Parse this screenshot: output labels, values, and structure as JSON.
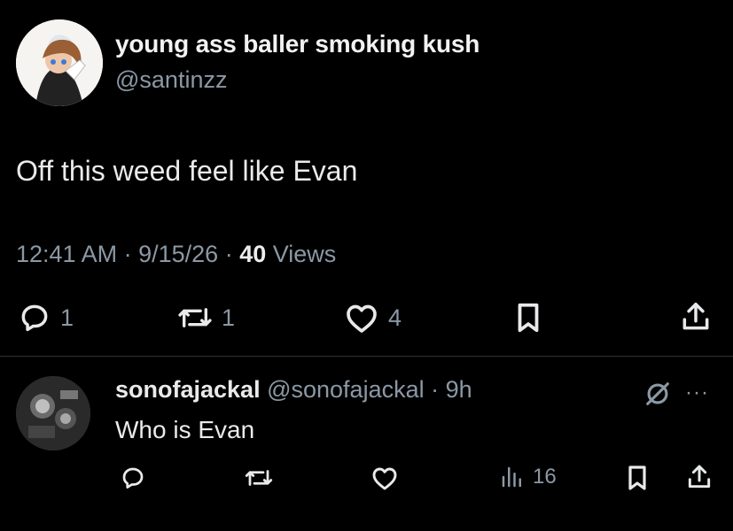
{
  "tweet": {
    "display_name": "young ass baller smoking kush",
    "handle": "@santinzz",
    "text": "Off this weed feel like Evan",
    "time": "12:41 AM",
    "date": "9/15/26",
    "views_count": "40",
    "views_label": "Views",
    "actions": {
      "reply_count": "1",
      "retweet_count": "1",
      "like_count": "4"
    }
  },
  "reply": {
    "display_name": "sonofajackal",
    "handle": "@sonofajackal",
    "age": "9h",
    "text": "Who is Evan",
    "views_count": "16"
  },
  "colors": {
    "background": "#000000",
    "text": "#e7e9ea",
    "muted": "#8b98a5",
    "divider": "#2f3336"
  }
}
